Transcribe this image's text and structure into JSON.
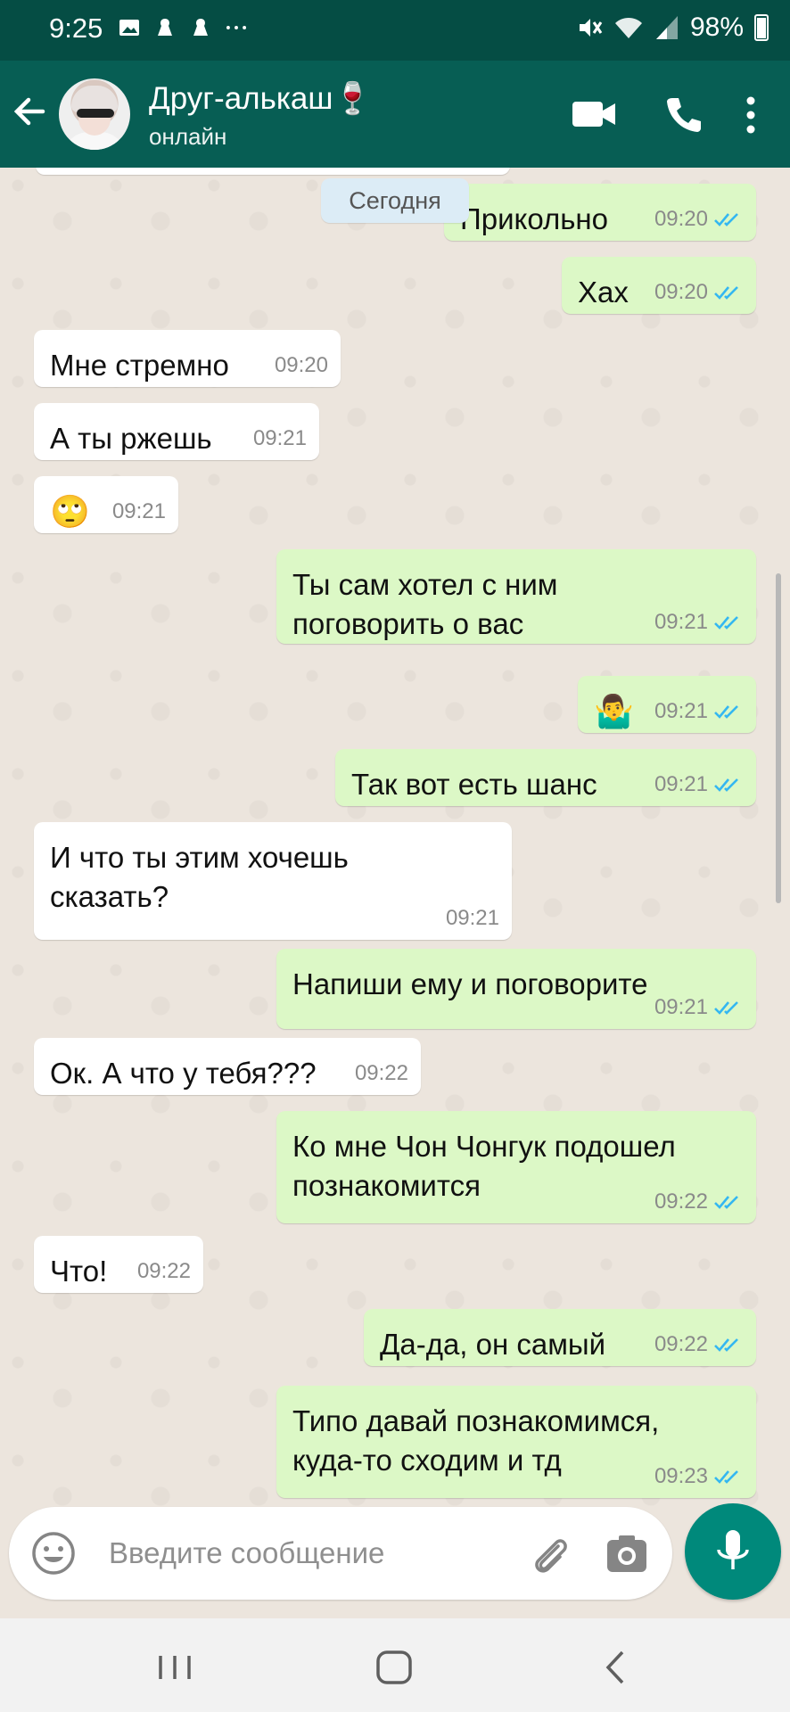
{
  "status_bar": {
    "time": "9:25",
    "battery": "98%",
    "icons": [
      "image-icon",
      "bts-icon",
      "bts-icon",
      "more-dots-icon",
      "mute-icon",
      "wifi-icon",
      "signal-icon",
      "battery-icon"
    ]
  },
  "header": {
    "contact_name": "Друг-алькаш",
    "contact_emoji": "🍷",
    "status": "онлайн"
  },
  "chat": {
    "date_label": "Сегодня",
    "messages": [
      {
        "dir": "out",
        "text": "Прикольно",
        "time": "09:20"
      },
      {
        "dir": "out",
        "text": "Хах",
        "time": "09:20"
      },
      {
        "dir": "in",
        "text": "Мне стремно",
        "time": "09:20"
      },
      {
        "dir": "in",
        "text": "А ты ржешь",
        "time": "09:21"
      },
      {
        "dir": "in",
        "text": "🙄",
        "time": "09:21"
      },
      {
        "dir": "out",
        "text": "Ты сам хотел с ним\nпоговорить о вас",
        "time": "09:21"
      },
      {
        "dir": "out",
        "text": "🤷‍♂️",
        "time": "09:21"
      },
      {
        "dir": "out",
        "text": "Так вот есть шанс",
        "time": "09:21"
      },
      {
        "dir": "in",
        "text": "И что ты этим хочешь\nсказать?",
        "time": "09:21"
      },
      {
        "dir": "out",
        "text": "Напиши ему и поговорите",
        "time": "09:21"
      },
      {
        "dir": "in",
        "text": "Ок. А что у тебя???",
        "time": "09:22"
      },
      {
        "dir": "out",
        "text": "Ко мне Чон Чонгук подошел\nпознакомится",
        "time": "09:22"
      },
      {
        "dir": "in",
        "text": "Что!",
        "time": "09:22"
      },
      {
        "dir": "out",
        "text": "Да-да, он самый",
        "time": "09:22"
      },
      {
        "dir": "out",
        "text": "Типо давай познакомимся,\nкуда-то сходим и тд",
        "time": "09:23"
      }
    ]
  },
  "input": {
    "placeholder": "Введите сообщение"
  },
  "colors": {
    "header": "#075e54",
    "status_bar": "#054d44",
    "outgoing": "#dcf8c6",
    "incoming": "#ffffff",
    "tick_read": "#34b7f1",
    "fab": "#00897b"
  }
}
